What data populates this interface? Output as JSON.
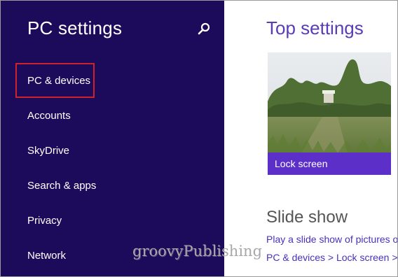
{
  "sidebar": {
    "title": "PC settings",
    "search_icon": "search-icon",
    "items": [
      {
        "label": "PC & devices",
        "selected": true
      },
      {
        "label": "Accounts"
      },
      {
        "label": "SkyDrive"
      },
      {
        "label": "Search & apps"
      },
      {
        "label": "Privacy"
      },
      {
        "label": "Network"
      }
    ]
  },
  "main": {
    "title": "Top settings",
    "tile": {
      "label": "Lock screen"
    },
    "slideshow": {
      "heading": "Slide show",
      "description": "Play a slide show of pictures o",
      "path": "PC & devices > Lock screen >"
    }
  },
  "watermark": "groovyPublishing",
  "colors": {
    "sidebar_bg": "#1c0b5a",
    "accent": "#5b2fc8",
    "highlight_border": "#d0202a"
  }
}
